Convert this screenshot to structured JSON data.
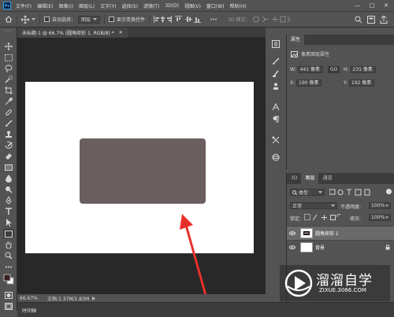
{
  "menubar": {
    "logo": "Ps",
    "items": [
      "文件(F)",
      "编辑(E)",
      "图像(I)",
      "图层(L)",
      "文字(Y)",
      "选择(S)",
      "滤镜(T)",
      "3D(D)",
      "视图(V)",
      "窗口(W)",
      "帮助(H)"
    ],
    "window_controls": {
      "minimize": "—",
      "maximize": "□",
      "close": "✕"
    }
  },
  "options": {
    "auto_select_label": "自动选择：",
    "auto_select_value": "图层",
    "show_transform_label": "显示变换控件",
    "mode_3d": "3D 模式："
  },
  "document": {
    "tab_title": "未标题-1 @ 66.7% (圆角矩形 1, RGB/8) *",
    "tab_close": "✕",
    "zoom": "66.67%",
    "doc_info": "文档:1.37M/1.83M",
    "canvas_bg": "#ffffff",
    "shape_color": "#6b5e5f",
    "arrow_color": "#e8302a"
  },
  "timeline": {
    "label": "时间轴"
  },
  "properties": {
    "tab": "属性",
    "section_title": "像素图层属性",
    "w_label": "W:",
    "w_value": "441 像素",
    "link_label": "GO",
    "h_label": "H:",
    "h_value": "231 像素",
    "x_label": "X:",
    "x_value": "190 像素",
    "y_label": "Y:",
    "y_value": "192 像素"
  },
  "layers": {
    "tabs": [
      "3D",
      "图层",
      "通道"
    ],
    "filter_label": "类型",
    "blend_mode": "正常",
    "opacity_label": "不透明度:",
    "opacity_value": "100%",
    "lock_label": "锁定:",
    "fill_label": "填充:",
    "fill_value": "100%",
    "rows": [
      {
        "name": "圆角矩形 1"
      },
      {
        "name": "背景"
      }
    ]
  },
  "watermark": {
    "brand": "溜溜自学",
    "url": "ZIXUE.3066.COM"
  }
}
